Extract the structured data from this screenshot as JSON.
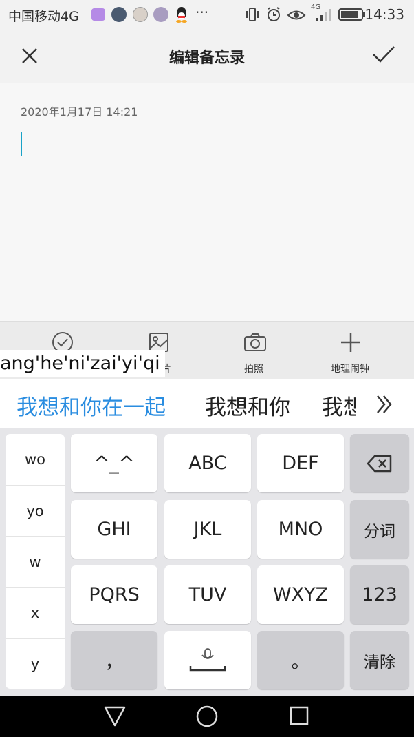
{
  "status_bar": {
    "carrier": "中国移动4G",
    "time": "14:33",
    "network": "4G"
  },
  "title_bar": {
    "title": "编辑备忘录"
  },
  "editor": {
    "date": "2020年1月17日 14:21",
    "content": ""
  },
  "toolbar": {
    "items": [
      {
        "label": "",
        "icon": "checklist-icon"
      },
      {
        "label": "片",
        "icon": "image-icon"
      },
      {
        "label": "拍照",
        "icon": "camera-icon"
      },
      {
        "label": "地理闹钟",
        "icon": "plus-icon"
      }
    ]
  },
  "ime": {
    "pinyin": "ang'he'ni'zai'yi'qi",
    "candidates": [
      "我想和你在一起",
      "我想和你",
      "我想"
    ],
    "accent_color": "#2a8de0",
    "side_keys": [
      "wo",
      "yo",
      "w",
      "x",
      "y"
    ],
    "keys": {
      "emoticon": "^_^",
      "abc": "ABC",
      "def": "DEF",
      "ghi": "GHI",
      "jkl": "JKL",
      "mno": "MNO",
      "split": "分词",
      "pqrs": "PQRS",
      "tuv": "TUV",
      "wxyz": "WXYZ",
      "num": "123",
      "comma": "，",
      "period": "。",
      "clear": "清除"
    }
  }
}
